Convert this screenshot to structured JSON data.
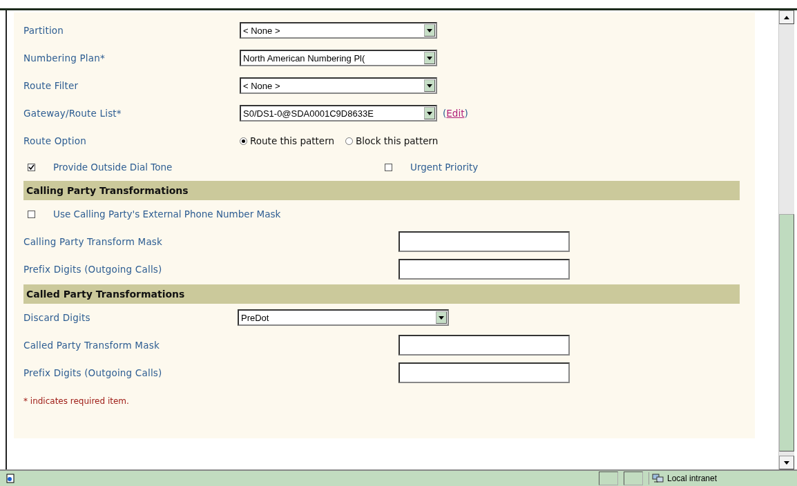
{
  "form": {
    "rows": [
      {
        "kind": "select",
        "label": "Partition",
        "value": "< None >"
      },
      {
        "kind": "select",
        "label": "Numbering Plan*",
        "value": "North American Numbering Pl("
      },
      {
        "kind": "select",
        "label": "Route Filter",
        "value": "< None >"
      },
      {
        "kind": "select",
        "label": "Gateway/Route List*",
        "value": "S0/DS1-0@SDA0001C9D8633E",
        "link": {
          "open": "(",
          "text": "Edit",
          "close": ")"
        }
      },
      {
        "kind": "radio",
        "label": "Route Option",
        "options": [
          {
            "label": "Route this pattern",
            "selected": true
          },
          {
            "label": "Block this pattern",
            "selected": false
          }
        ]
      },
      {
        "kind": "checks",
        "items": [
          {
            "label": "Provide Outside Dial Tone",
            "checked": true
          },
          {
            "label": "Urgent Priority",
            "checked": false
          }
        ]
      },
      {
        "kind": "header",
        "title": "Calling Party Transformations"
      },
      {
        "kind": "check",
        "label": "Use Calling Party's External Phone Number Mask",
        "checked": false
      },
      {
        "kind": "text",
        "label": "Calling Party Transform Mask"
      },
      {
        "kind": "text",
        "label": "Prefix Digits (Outgoing Calls)"
      },
      {
        "kind": "header",
        "title": "Called Party Transformations"
      },
      {
        "kind": "select",
        "label": "Discard Digits",
        "value": "PreDot",
        "wide": true
      },
      {
        "kind": "text",
        "label": "Called Party Transform Mask"
      },
      {
        "kind": "text",
        "label": "Prefix Digits (Outgoing Calls)"
      }
    ],
    "note": "* indicates required item."
  },
  "status_bar": {
    "zone": "Local intranet"
  }
}
